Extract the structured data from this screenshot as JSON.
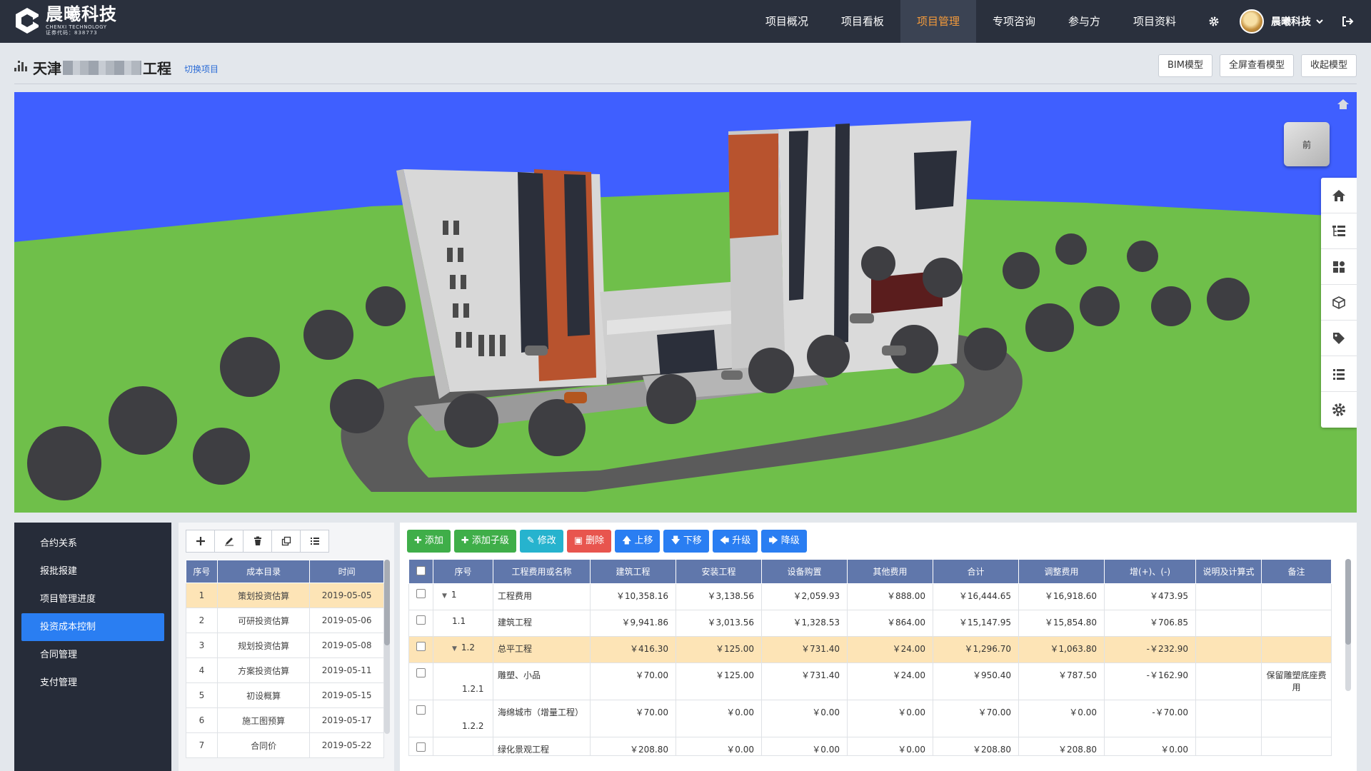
{
  "brand": {
    "name_cn": "晨曦科技",
    "name_en": "CHENXI TECHNOLOGY",
    "code": "证券代码：838773"
  },
  "nav": [
    {
      "label": "项目概况",
      "active": false
    },
    {
      "label": "项目看板",
      "active": false
    },
    {
      "label": "项目管理",
      "active": true
    },
    {
      "label": "专项咨询",
      "active": false
    },
    {
      "label": "参与方",
      "active": false
    },
    {
      "label": "项目资料",
      "active": false
    }
  ],
  "user": {
    "name": "晨曦科技"
  },
  "project": {
    "title_prefix": "天津",
    "title_suffix": "工程",
    "switch_label": "切换项目"
  },
  "top_buttons": {
    "bim": "BIM模型",
    "fullscreen": "全屏查看模型",
    "collapse": "收起模型"
  },
  "viewer": {
    "cube_label": "前",
    "icons": [
      "home-icon",
      "tree-icon",
      "layers-icon",
      "cube-icon",
      "tag-icon",
      "list-icon",
      "settings-icon"
    ]
  },
  "sidebar": [
    {
      "label": "合约关系",
      "active": false
    },
    {
      "label": "报批报建",
      "active": false
    },
    {
      "label": "项目管理进度",
      "active": false
    },
    {
      "label": "投资成本控制",
      "active": true
    },
    {
      "label": "合同管理",
      "active": false
    },
    {
      "label": "支付管理",
      "active": false
    }
  ],
  "catalog": {
    "headers": [
      "序号",
      "成本目录",
      "时间"
    ],
    "rows": [
      {
        "no": "1",
        "name": "策划投资估算",
        "date": "2019-05-05",
        "selected": true
      },
      {
        "no": "2",
        "name": "可研投资估算",
        "date": "2019-05-06",
        "selected": false
      },
      {
        "no": "3",
        "name": "规划投资估算",
        "date": "2019-05-08",
        "selected": false
      },
      {
        "no": "4",
        "name": "方案投资估算",
        "date": "2019-05-11",
        "selected": false
      },
      {
        "no": "5",
        "name": "初设概算",
        "date": "2019-05-15",
        "selected": false
      },
      {
        "no": "6",
        "name": "施工图预算",
        "date": "2019-05-17",
        "selected": false
      },
      {
        "no": "7",
        "name": "合同价",
        "date": "2019-05-22",
        "selected": false
      }
    ]
  },
  "actions": {
    "add": "添加",
    "add_child": "添加子级",
    "edit": "修改",
    "delete": "删除",
    "up": "上移",
    "down": "下移",
    "promote": "升级",
    "demote": "降级"
  },
  "grid": {
    "headers": [
      "序号",
      "工程费用或名称",
      "建筑工程",
      "安装工程",
      "设备购置",
      "其他费用",
      "合计",
      "调整费用",
      "增(+)、(-)",
      "说明及计算式",
      "备注"
    ],
    "rows": [
      {
        "no": "1",
        "tree": "▼",
        "indent": 0,
        "name": "工程费用",
        "build": "￥10,358.16",
        "install": "￥3,138.56",
        "equip": "￥2,059.93",
        "other": "￥888.00",
        "total": "￥16,444.65",
        "adjust": "￥16,918.60",
        "diff": "￥473.95",
        "note": "",
        "remark": "",
        "selected": false
      },
      {
        "no": "1.1",
        "tree": "",
        "indent": 1,
        "name": "建筑工程",
        "build": "￥9,941.86",
        "install": "￥3,013.56",
        "equip": "￥1,328.53",
        "other": "￥864.00",
        "total": "￥15,147.95",
        "adjust": "￥15,854.80",
        "diff": "￥706.85",
        "note": "",
        "remark": "",
        "selected": false
      },
      {
        "no": "1.2",
        "tree": "▼",
        "indent": 1,
        "name": "总平工程",
        "build": "￥416.30",
        "install": "￥125.00",
        "equip": "￥731.40",
        "other": "￥24.00",
        "total": "￥1,296.70",
        "adjust": "￥1,063.80",
        "diff": "-￥232.90",
        "note": "",
        "remark": "",
        "selected": true
      },
      {
        "no": "1.2.1",
        "tree": "",
        "indent": 2,
        "name": "雕塑、小品",
        "build": "￥70.00",
        "install": "￥125.00",
        "equip": "￥731.40",
        "other": "￥24.00",
        "total": "￥950.40",
        "adjust": "￥787.50",
        "diff": "-￥162.90",
        "note": "",
        "remark": "保留雕塑底座费用",
        "selected": false
      },
      {
        "no": "1.2.2",
        "tree": "",
        "indent": 2,
        "name": "海绵城市（增量工程）",
        "build": "￥70.00",
        "install": "￥0.00",
        "equip": "￥0.00",
        "other": "￥0.00",
        "total": "￥70.00",
        "adjust": "￥0.00",
        "diff": "-￥70.00",
        "note": "",
        "remark": "",
        "selected": false
      },
      {
        "no": "",
        "tree": "",
        "indent": 2,
        "name": "绿化景观工程",
        "build": "￥208.80",
        "install": "￥0.00",
        "equip": "￥0.00",
        "other": "￥0.00",
        "total": "￥208.80",
        "adjust": "￥208.80",
        "diff": "￥0.00",
        "note": "",
        "remark": "",
        "selected": false
      }
    ]
  },
  "colors": {
    "header_bg": "#2a303d",
    "accent": "#f39a3b",
    "primary": "#2a7ef2",
    "table_head": "#6077ab",
    "selected_row": "#fde4b6",
    "sky": "#3f5fff",
    "grass": "#6fbf4a"
  }
}
